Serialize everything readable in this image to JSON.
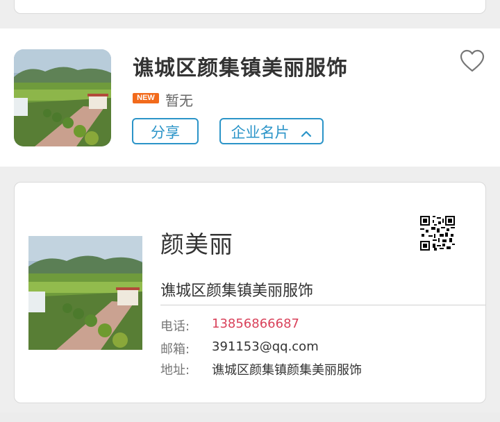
{
  "company": {
    "name": "谯城区颜集镇美丽服饰",
    "badge": "NEW",
    "status": "暂无",
    "share_label": "分享",
    "card_label": "企业名片"
  },
  "icons": {
    "favorite": "heart-outline-icon",
    "collapse": "chevron-up-icon"
  },
  "card": {
    "person_name": "颜美丽",
    "company": "谯城区颜集镇美丽服饰",
    "phone_label": "电话:",
    "phone": "13856866687",
    "email_label": "邮箱:",
    "email": "391153@qq.com",
    "address_label": "地址:",
    "address": "谯城区颜集镇颜集美丽服饰"
  },
  "colors": {
    "accent_blue": "#2b94c8",
    "badge_orange": "#f26a1b",
    "phone_red": "#d9415a"
  }
}
